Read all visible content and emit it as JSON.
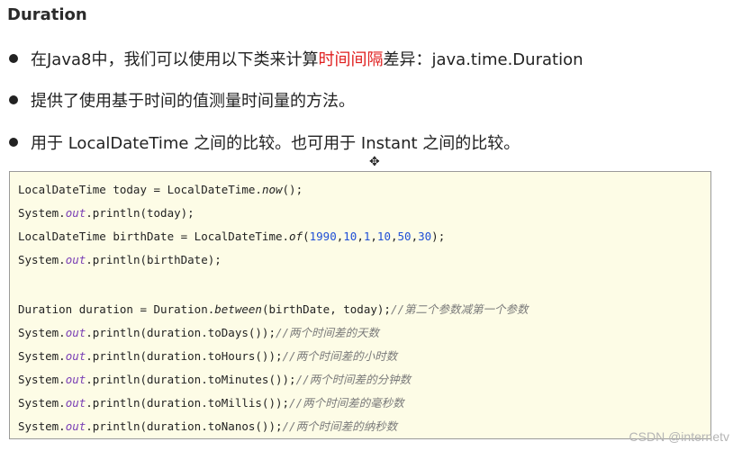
{
  "title": "Duration",
  "bullets": {
    "b1_pre": "在Java8中，我们可以使用以下类来计算",
    "b1_highlight": "时间间隔",
    "b1_post": "差异：java.time.Duration",
    "b2": "提供了使用基于时间的值测量时间量的方法。",
    "b3": "用于 LocalDateTime 之间的比较。也可用于 Instant 之间的比较。"
  },
  "code": {
    "l1a": "LocalDateTime today = LocalDateTime.",
    "l1b": "now",
    "l1c": "();",
    "l2a": "System.",
    "l2b": "out",
    "l2c": ".println(today);",
    "l3a": "LocalDateTime birthDate = LocalDateTime.",
    "l3b": "of",
    "l3c": "(",
    "l3n1": "1990",
    "l3n2": "10",
    "l3n3": "1",
    "l3n4": "10",
    "l3n5": "50",
    "l3n6": "30",
    "l3d": ");",
    "comma": ",",
    "l4c": ".println(birthDate);",
    "l5a": "Duration duration = Duration.",
    "l5b": "between",
    "l5c": "(birthDate, today);",
    "l5cm": "//第二个参数减第一个参数",
    "l6c": ".println(duration.toDays());",
    "l6cm": "//两个时间差的天数",
    "l7c": ".println(duration.toHours());",
    "l7cm": "//两个时间差的小时数",
    "l8c": ".println(duration.toMinutes());",
    "l8cm": "//两个时间差的分钟数",
    "l9c": ".println(duration.toMillis());",
    "l9cm": "//两个时间差的毫秒数",
    "l10c": ".println(duration.toNanos());",
    "l10cm": "//两个时间差的纳秒数"
  },
  "watermark": "CSDN @internetv"
}
